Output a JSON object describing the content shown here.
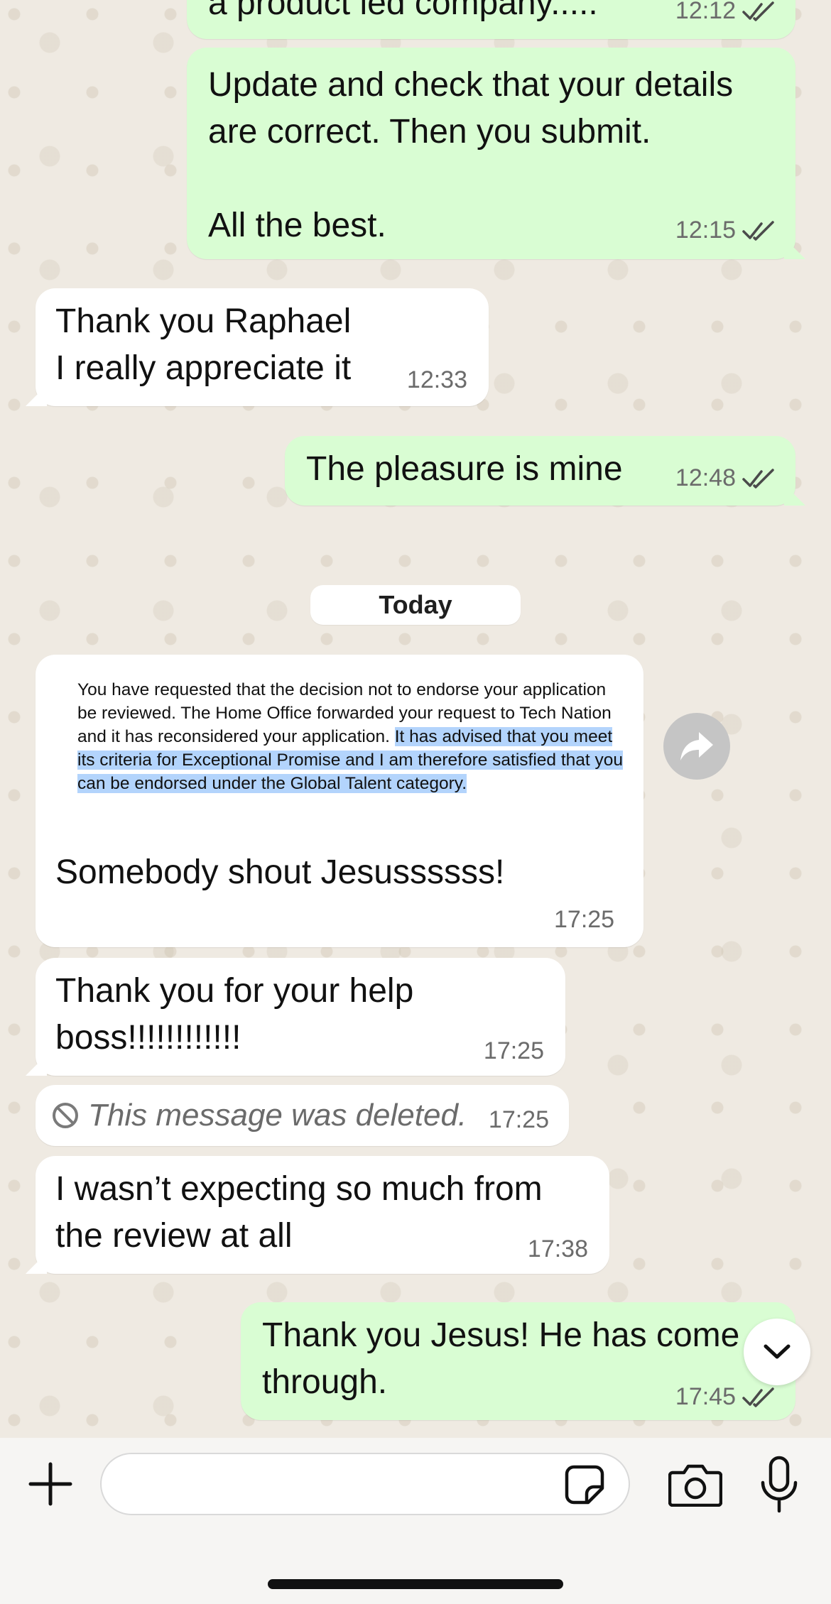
{
  "day_separator": "Today",
  "messages": [
    {
      "text": "a product led company.....",
      "time": "12:12"
    },
    {
      "text": "Update and check that your details\nare correct. Then you submit.\n\nAll the best.",
      "time": "12:15"
    },
    {
      "text": "Thank you Raphael\nI really appreciate it",
      "time": "12:33"
    },
    {
      "text": "The pleasure is mine",
      "time": "12:48"
    },
    {
      "quote_plain": "You have requested that the decision not to endorse your application be reviewed. The Home Office forwarded your request to Tech Nation and it has reconsidered your application. ",
      "quote_highlight": "It has advised that you meet its criteria for Exceptional Promise and I am therefore satisfied that you can be endorsed under the Global Talent category.",
      "text": "Somebody shout Jesussssss!",
      "time": "17:25"
    },
    {
      "text": "Thank you for your help\nboss!!!!!!!!!!!!",
      "time": "17:25"
    },
    {
      "text": "This message was deleted.",
      "time": "17:25"
    },
    {
      "text": "I wasn’t expecting so much from\nthe review at all",
      "time": "17:38"
    },
    {
      "text": "Thank you Jesus! He has come\nthrough.",
      "time": "17:45"
    }
  ],
  "icons": {
    "attach": "plus-icon",
    "sticker": "sticker-icon",
    "camera": "camera-icon",
    "mic": "microphone-icon",
    "forward": "forward-icon",
    "scroll": "chevron-down-icon",
    "deleted": "blocked-icon",
    "read": "double-check-icon"
  },
  "colors": {
    "outgoing_bubble": "#d9fdd3",
    "incoming_bubble": "#ffffff",
    "selection": "#b3d4fc",
    "read_ticks": "#4a4a4a"
  }
}
